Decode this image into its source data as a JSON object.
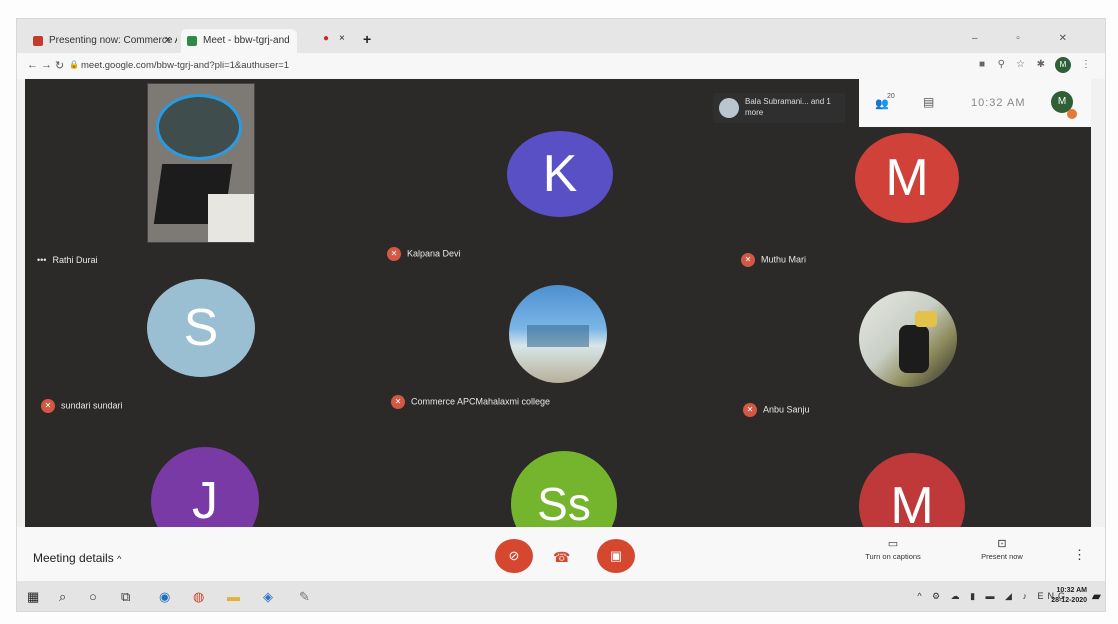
{
  "browser": {
    "tabs": [
      {
        "label": "Presenting now: Commerce APC",
        "close": "×",
        "fav_color": "#c23b2c"
      },
      {
        "label": "Meet - bbw-tgrj-and",
        "close": "×",
        "fav_color": "#2f8a4a"
      }
    ],
    "record_dot": "●",
    "new_tab": "+",
    "url": "meet.google.com/bbw-tgrj-and?pli=1&authuser=1",
    "profile_initial": "M"
  },
  "meeting": {
    "joined_notice": "Bala Subramani... and 1 more",
    "time": "10:32 AM",
    "participant_count": "20",
    "profile_initial": "M",
    "self_name": "Rathi Durai",
    "participants": [
      {
        "name": "Kalpana Devi",
        "initial": "K",
        "color": "#5a50c6"
      },
      {
        "name": "Muthu Mari",
        "initial": "M",
        "color": "#d0413a"
      },
      {
        "name": "sundari sundari",
        "initial": "S",
        "color": "#9bbfd2"
      },
      {
        "name": "Commerce APCMahalaxmi college",
        "initial": "",
        "color": "#5e9fd3"
      },
      {
        "name": "Anbu Sanju",
        "initial": "",
        "color": "#c8c8c0"
      },
      {
        "name": "",
        "initial": "J",
        "color": "#7a3aa6"
      },
      {
        "name": "",
        "initial": "Ss",
        "color": "#74b52d"
      },
      {
        "name": "",
        "initial": "M",
        "color": "#c0393a"
      }
    ]
  },
  "controls": {
    "meeting_details": "Meeting details",
    "captions": "Turn on captions",
    "present": "Present now",
    "accent": "#d5482f"
  },
  "taskbar": {
    "clock_time": "10:32 AM",
    "clock_date": "28-12-2020",
    "lang": "ENG"
  }
}
